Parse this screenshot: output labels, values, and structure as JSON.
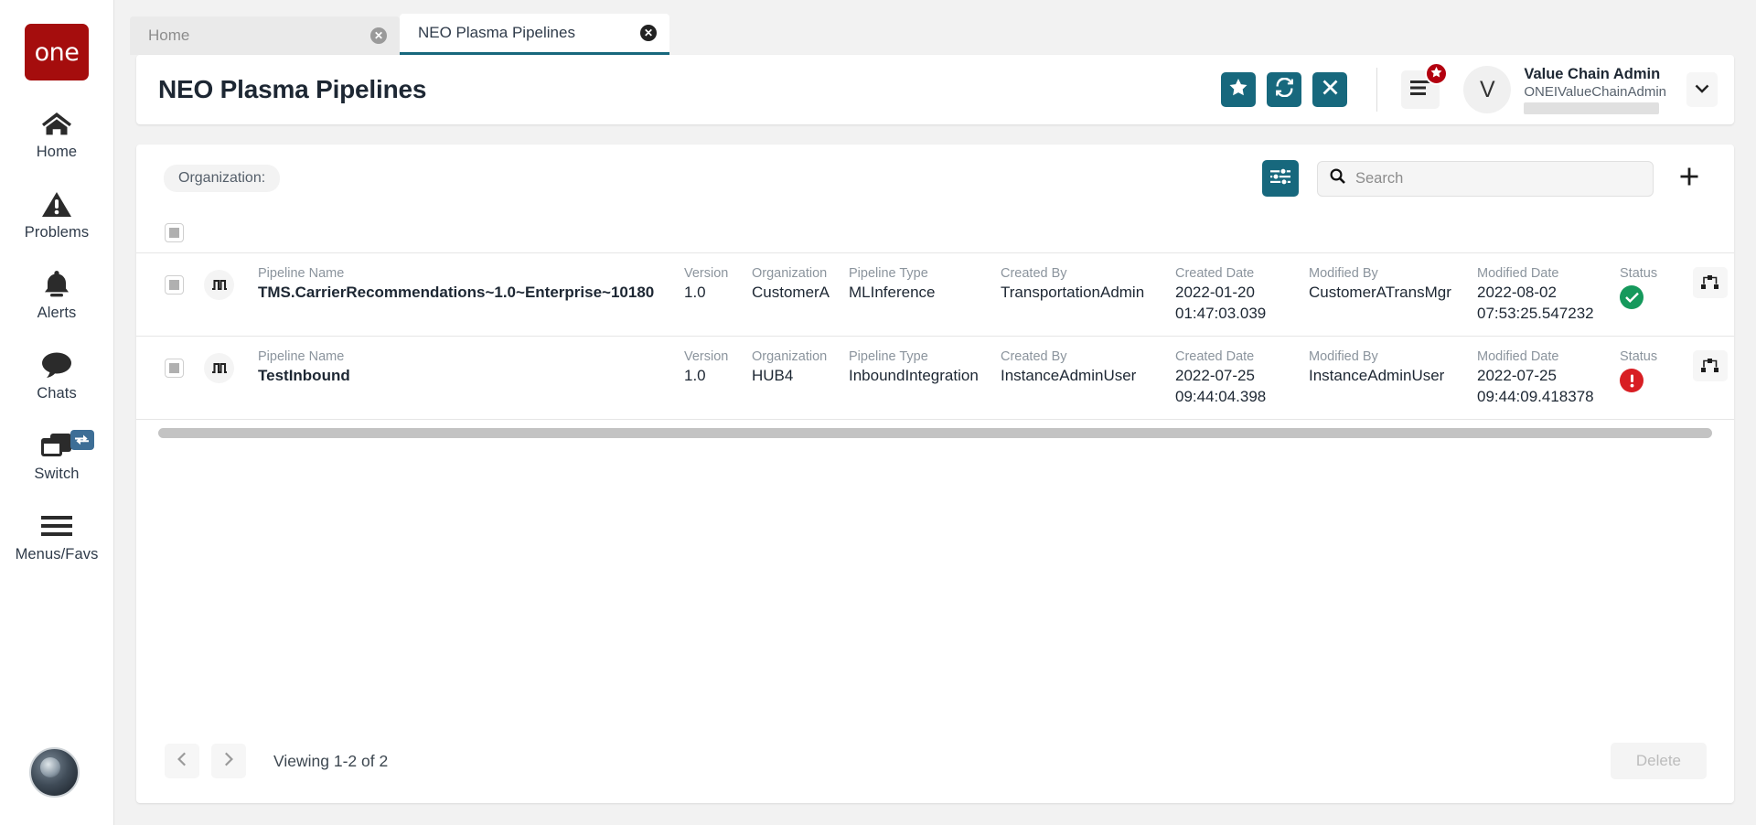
{
  "sidebar": {
    "logo_text": "one",
    "items": [
      {
        "label": "Home",
        "icon": "home-icon"
      },
      {
        "label": "Problems",
        "icon": "warning-triangle-icon"
      },
      {
        "label": "Alerts",
        "icon": "bell-icon"
      },
      {
        "label": "Chats",
        "icon": "chat-bubble-icon"
      },
      {
        "label": "Switch",
        "icon": "windows-stack-icon",
        "badge_icon": "switch-arrows-icon"
      },
      {
        "label": "Menus/Favs",
        "icon": "hamburger-icon"
      }
    ]
  },
  "tabs": [
    {
      "label": "Home",
      "active": false
    },
    {
      "label": "NEO Plasma Pipelines",
      "active": true
    }
  ],
  "header": {
    "title": "NEO Plasma Pipelines",
    "actions": [
      {
        "name": "favorite-button",
        "icon": "star-icon"
      },
      {
        "name": "refresh-button",
        "icon": "refresh-icon"
      },
      {
        "name": "close-button",
        "icon": "close-x-icon"
      }
    ],
    "menu_button_icon": "hamburger-icon",
    "menu_badge_icon": "star-icon",
    "user": {
      "avatar_initial": "V",
      "name": "Value Chain Admin",
      "login": "ONEIValueChainAdmin"
    },
    "chevron_icon": "chevron-down-icon"
  },
  "toolbar": {
    "organization_chip": "Organization:",
    "filter_icon": "sliders-filter-icon",
    "search": {
      "placeholder": "Search",
      "value": "",
      "icon": "search-icon"
    },
    "add_icon": "plus-icon"
  },
  "table": {
    "select_all_state": "indeterminate",
    "columns": {
      "name": "Pipeline Name",
      "version": "Version",
      "organization": "Organization",
      "type": "Pipeline Type",
      "created_by": "Created By",
      "created_date": "Created Date",
      "modified_by": "Modified By",
      "modified_date": "Modified Date",
      "status": "Status"
    },
    "row_actions": [
      {
        "name": "view-diagram-button",
        "icon": "sitemap-icon"
      },
      {
        "name": "edit-button",
        "icon": "pencil-icon"
      },
      {
        "name": "duplicate-button",
        "icon": "copy-icon"
      },
      {
        "name": "delete-row-button",
        "icon": "trash-icon"
      }
    ],
    "rows": [
      {
        "name": "TMS.CarrierRecommendations~1.0~Enterprise~10180",
        "version": "1.0",
        "organization": "CustomerA",
        "type": "MLInference",
        "created_by": "TransportationAdmin",
        "created_date_1": "2022-01-20",
        "created_date_2": "01:47:03.039",
        "modified_by": "CustomerATransMgr",
        "modified_date_1": "2022-08-02",
        "modified_date_2": "07:53:25.547232",
        "status": "success"
      },
      {
        "name": "TestInbound",
        "version": "1.0",
        "organization": "HUB4",
        "type": "InboundIntegration",
        "created_by": "InstanceAdminUser",
        "created_date_1": "2022-07-25",
        "created_date_2": "09:44:04.398",
        "modified_by": "InstanceAdminUser",
        "modified_date_1": "2022-07-25",
        "modified_date_2": "09:44:09.418378",
        "status": "error"
      }
    ]
  },
  "footer": {
    "prev_icon": "chevron-left-icon",
    "next_icon": "chevron-right-icon",
    "viewing_text": "Viewing 1-2 of 2",
    "delete_label": "Delete"
  },
  "colors": {
    "brand_red": "#a50d0d",
    "teal": "#17687d",
    "status_success": "#15995c",
    "status_error": "#d81e23",
    "badge_red": "#b3000f"
  }
}
